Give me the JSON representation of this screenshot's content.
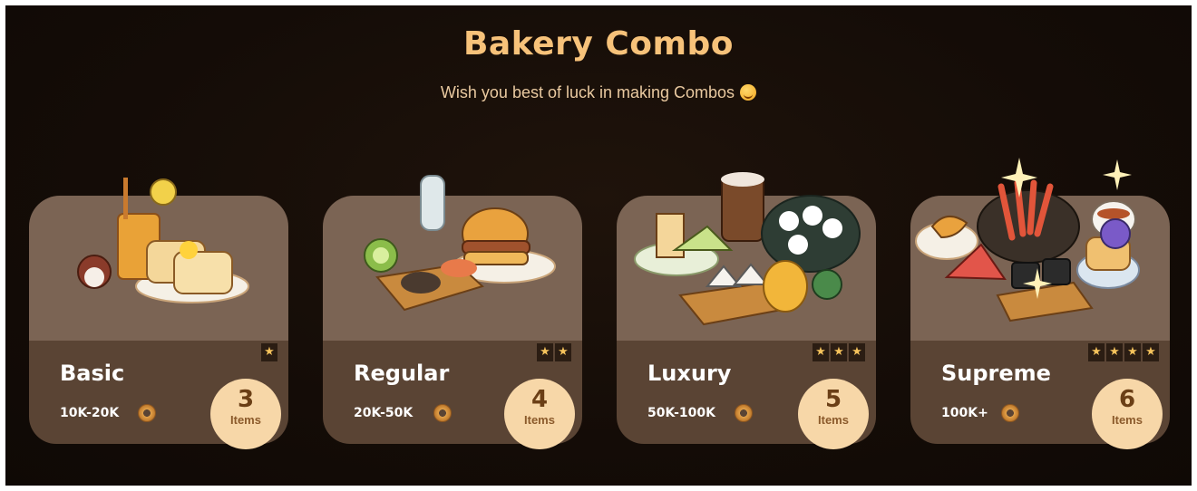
{
  "header": {
    "title": "Bakery Combo",
    "subtitle": "Wish you best of luck in making Combos"
  },
  "combos": [
    {
      "name": "Basic",
      "range": "10K-20K",
      "count": "3",
      "count_label": "Items",
      "stars": 1
    },
    {
      "name": "Regular",
      "range": "20K-50K",
      "count": "4",
      "count_label": "Items",
      "stars": 2
    },
    {
      "name": "Luxury",
      "range": "50K-100K",
      "count": "5",
      "count_label": "Items",
      "stars": 3
    },
    {
      "name": "Supreme",
      "range": "100K+",
      "count": "6",
      "count_label": "Items",
      "stars": 4
    }
  ],
  "icons": {
    "subtitle_emoji": "smiley-emoji-icon",
    "currency": "coin-icon",
    "rating": "star-icon"
  },
  "colors": {
    "title": "#f7c27a",
    "card_top": "#7b6454",
    "card_bottom": "#5a4434",
    "badge": "#f7d7a8"
  }
}
